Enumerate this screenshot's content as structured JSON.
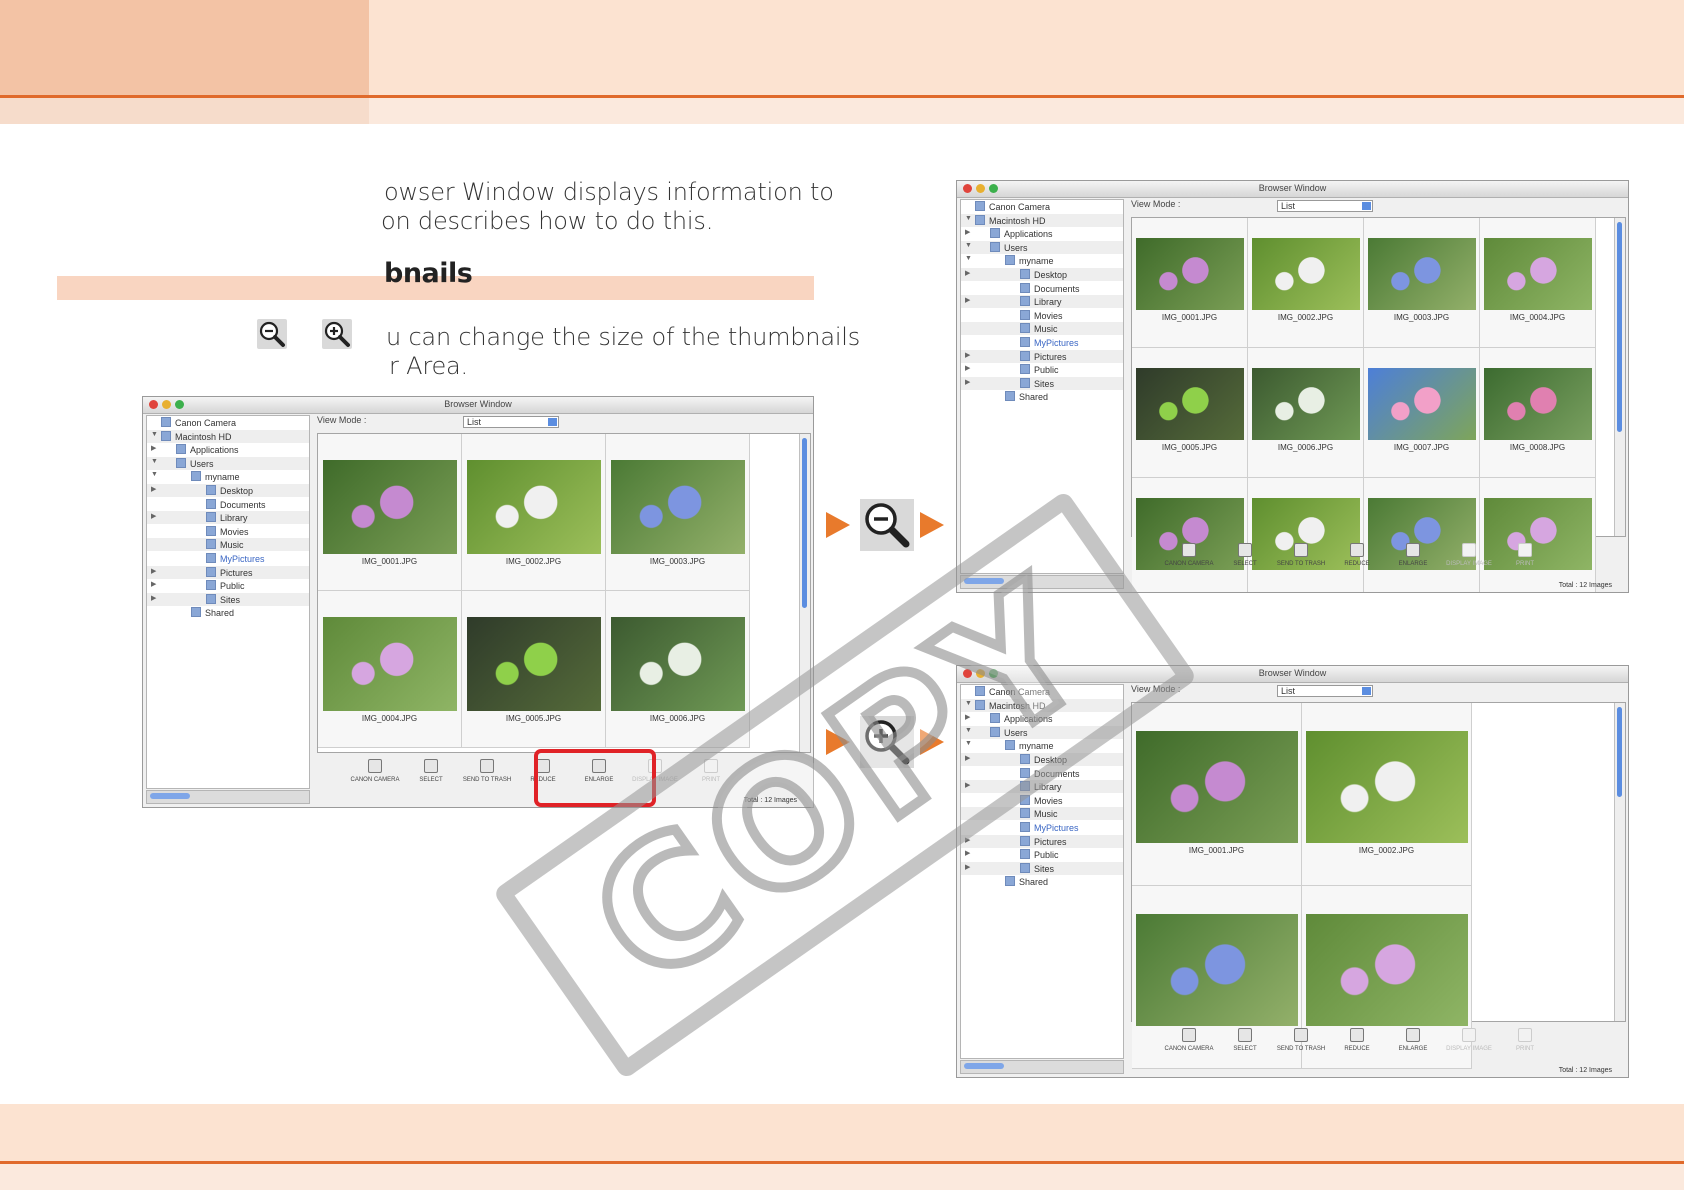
{
  "intro": {
    "line1": "owser Window displays information to",
    "line2": "on describes how to do this."
  },
  "section": {
    "title": "bnails",
    "text_line1": "u can change the size of the thumbnails",
    "text_line2": "r Area."
  },
  "icons": {
    "reduce": "zoom-out-icon",
    "enlarge": "zoom-in-icon"
  },
  "window": {
    "title": "Browser Window",
    "view_mode_label": "View Mode :",
    "view_mode_value": "List",
    "tree": [
      {
        "label": "Canon Camera",
        "indent": 0,
        "arrow": ""
      },
      {
        "label": "Macintosh HD",
        "indent": 0,
        "arrow": "▼"
      },
      {
        "label": "Applications",
        "indent": 1,
        "arrow": "▶"
      },
      {
        "label": "Users",
        "indent": 1,
        "arrow": "▼"
      },
      {
        "label": "myname",
        "indent": 2,
        "arrow": "▼"
      },
      {
        "label": "Desktop",
        "indent": 3,
        "arrow": "▶"
      },
      {
        "label": "Documents",
        "indent": 3,
        "arrow": ""
      },
      {
        "label": "Library",
        "indent": 3,
        "arrow": "▶"
      },
      {
        "label": "Movies",
        "indent": 3,
        "arrow": ""
      },
      {
        "label": "Music",
        "indent": 3,
        "arrow": ""
      },
      {
        "label": "MyPictures",
        "indent": 3,
        "arrow": "",
        "selected": true
      },
      {
        "label": "Pictures",
        "indent": 3,
        "arrow": "▶"
      },
      {
        "label": "Public",
        "indent": 3,
        "arrow": "▶"
      },
      {
        "label": "Sites",
        "indent": 3,
        "arrow": "▶"
      },
      {
        "label": "Shared",
        "indent": 2,
        "arrow": ""
      }
    ],
    "toolbar": [
      {
        "label": "CANON CAMERA",
        "disabled": false
      },
      {
        "label": "SELECT",
        "disabled": false
      },
      {
        "label": "SEND TO TRASH",
        "disabled": false
      },
      {
        "label": "REDUCE",
        "disabled": false
      },
      {
        "label": "ENLARGE",
        "disabled": false
      },
      {
        "label": "DISPLAY IMAGE",
        "disabled": true
      },
      {
        "label": "PRINT",
        "disabled": true
      }
    ],
    "total": "Total : 12 Images",
    "images": [
      "IMG_0001.JPG",
      "IMG_0002.JPG",
      "IMG_0003.JPG",
      "IMG_0004.JPG",
      "IMG_0005.JPG",
      "IMG_0006.JPG",
      "IMG_0007.JPG",
      "IMG_0008.JPG"
    ]
  },
  "watermark": "COPY",
  "colors": {
    "accent": "#e06a2b",
    "band": "#fce3d1",
    "highlight": "#e02227",
    "arrow": "#e87a2c"
  }
}
